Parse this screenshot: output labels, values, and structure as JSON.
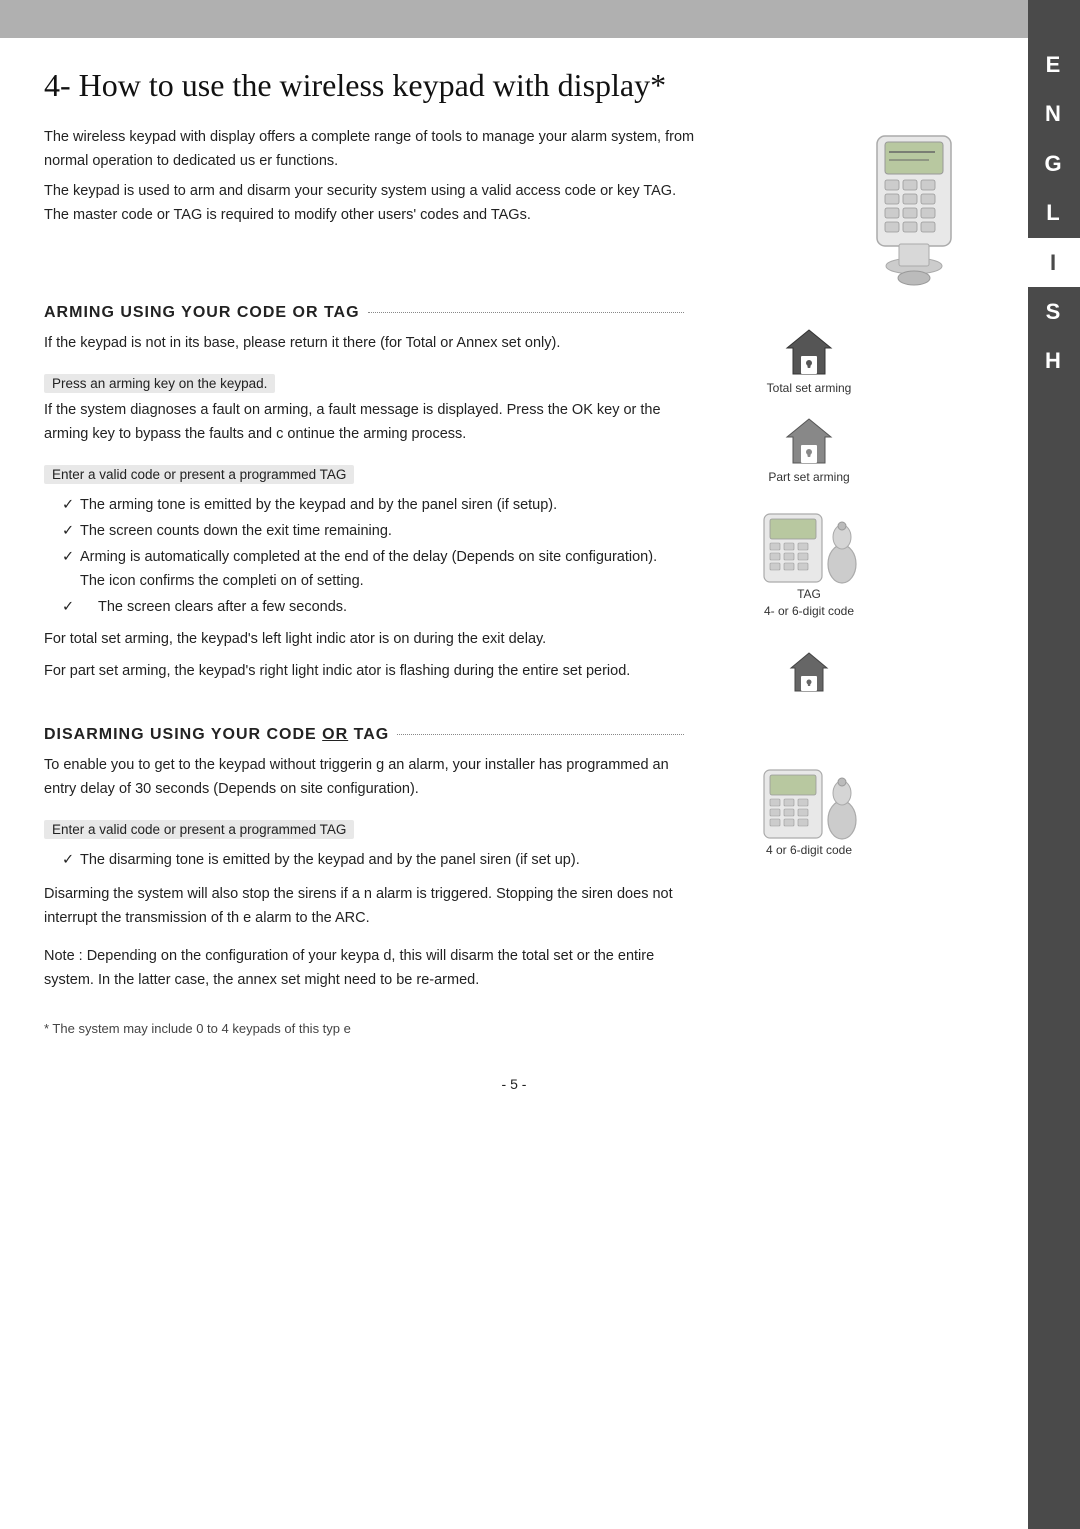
{
  "sidebar": {
    "letters": [
      "E",
      "N",
      "G",
      "L",
      "I",
      "S",
      "H"
    ],
    "active": "I"
  },
  "page": {
    "title": "4-  How to use the wireless keypad with display*",
    "intro_p1": "The wireless keypad with display offers a complete  range of tools to manage your alarm system, from normal operation to dedicated us er functions.",
    "intro_p2": "The keypad is used to arm and disarm your security  system using a valid access code or key TAG. The master code or TAG is required to modify other users' codes and TAGs.",
    "section1_heading": "ARMING USING YOUR CODE OR TAG",
    "arming_intro": "If the keypad is not in its base, please return it  there (for Total or Annex set only).",
    "step1_label": "Press an arming key on the keypad.",
    "step1_body": "If the system diagnoses a fault on arming, a fault  message is displayed. Press the OK key or the arming key to bypass the faults and c ontinue the arming process.",
    "step2_label": "Enter a valid code or present a programmed TAG",
    "bullet1": "The arming tone is emitted by the keypad and by the  panel siren (if setup).",
    "bullet2": "The screen counts down the exit time remaining.",
    "bullet3": "Arming is automatically completed at the end of the  delay (Depends on site configuration). The icon confirms the completi on of setting.",
    "bullet3b": "The screen clears after a few seconds.",
    "arming_note1": "For total set arming, the keypad's left light indic ator is on during the exit delay.",
    "arming_note2": "For part set arming, the keypad's right light indic ator is flashing during the entire set period.",
    "section2_heading": "DISARMING USING YOUR CODE OR TAG",
    "disarming_intro": "To enable you to get to the keypad without triggerin g an alarm, your installer has programmed an entry delay of 30 seconds (Depends on  site configuration).",
    "step3_label": "Enter a valid code or present a programmed TAG",
    "disarm_bullet1": "The disarming tone is emitted by the keypad and by  the panel siren (if set up).",
    "disarming_note1": "Disarming the system will also stop the sirens if a n alarm is triggered. Stopping the siren does not interrupt the transmission of th e alarm to the ARC.",
    "note_config": "Note : Depending on the configuration of your keypa d, this will disarm the total set or the entire system. In the latter case, the annex set might need to be re-armed.",
    "footnote": "* The system may include 0 to 4 keypads of this typ e",
    "page_number": "- 5 -",
    "total_set_arming_label": "Total set arming",
    "part_set_arming_label": "Part set arming",
    "tag_label": "TAG",
    "tag_sublabel": "4- or 6-digit code",
    "digit_code_label": "4 or 6-digit code"
  }
}
